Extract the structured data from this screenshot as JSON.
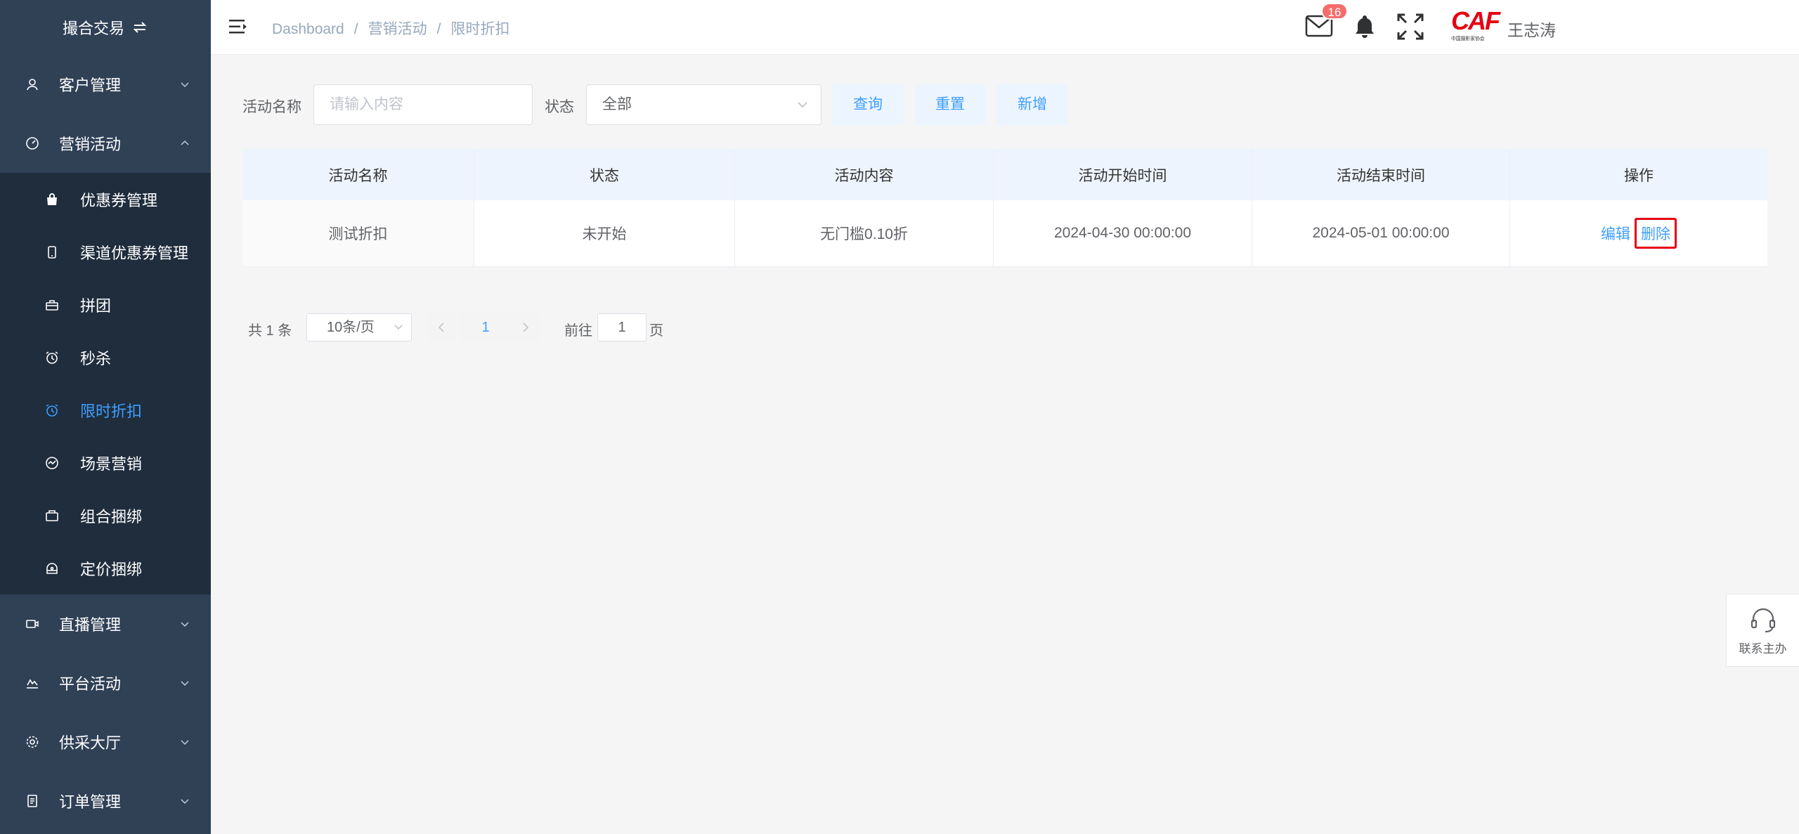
{
  "sidebar": {
    "title": "撮合交易",
    "menu": [
      {
        "label": "客户管理",
        "icon": "user-icon"
      },
      {
        "label": "营销活动",
        "icon": "dashboard-icon"
      }
    ],
    "submenu": [
      {
        "label": "优惠券管理",
        "icon": "bag-icon"
      },
      {
        "label": "渠道优惠券管理",
        "icon": "phone-icon"
      },
      {
        "label": "拼团",
        "icon": "group-icon"
      },
      {
        "label": "秒杀",
        "icon": "alarm-icon"
      },
      {
        "label": "限时折扣",
        "icon": "alarm-icon"
      },
      {
        "label": "场景营销",
        "icon": "chart-circle-icon"
      },
      {
        "label": "组合捆绑",
        "icon": "box-icon"
      },
      {
        "label": "定价捆绑",
        "icon": "bundle-icon"
      }
    ],
    "menu_bottom": [
      {
        "label": "直播管理",
        "icon": "video-icon"
      },
      {
        "label": "平台活动",
        "icon": "activity-icon"
      },
      {
        "label": "供采大厅",
        "icon": "gear-icon"
      },
      {
        "label": "订单管理",
        "icon": "document-icon"
      }
    ]
  },
  "header": {
    "breadcrumb": [
      "Dashboard",
      "营销活动",
      "限时折扣"
    ],
    "mail_badge": "16",
    "logo_text": "CAF",
    "logo_sub": "中国摄影家协会",
    "username": "王志涛"
  },
  "filter": {
    "name_label": "活动名称",
    "name_placeholder": "请输入内容",
    "status_label": "状态",
    "status_value": "全部",
    "query": "查询",
    "reset": "重置",
    "add": "新增"
  },
  "table": {
    "columns": [
      "活动名称",
      "状态",
      "活动内容",
      "活动开始时间",
      "活动结束时间",
      "操作"
    ],
    "rows": [
      {
        "name": "测试折扣",
        "status": "未开始",
        "content": "无门槛0.10折",
        "start": "2024-04-30 00:00:00",
        "end": "2024-05-01 00:00:00",
        "edit": "编辑",
        "delete": "删除"
      }
    ]
  },
  "pagination": {
    "total": "共 1 条",
    "page_size": "10条/页",
    "current": "1",
    "goto_label": "前往",
    "goto_value": "1",
    "page_suffix": "页"
  },
  "contact": {
    "label": "联系主办"
  },
  "colors": {
    "sidebar_bg": "#304156",
    "submenu_bg": "#1f2d3d",
    "accent": "#409eff",
    "badge": "#f56c6c",
    "highlight_border": "#e60012"
  }
}
